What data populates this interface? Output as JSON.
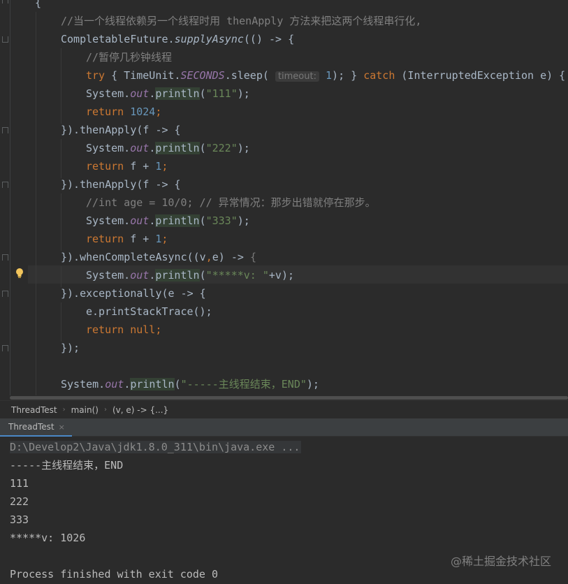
{
  "editor": {
    "lines": [
      {
        "tokens": [
          {
            "t": "{",
            "c": ""
          }
        ]
      },
      {
        "tokens": [
          {
            "t": "//当一个线程依赖另一个线程时用 thenApply 方法来把这两个线程串行化,",
            "c": "c-cm"
          }
        ]
      },
      {
        "tokens": [
          {
            "t": "CompletableFuture.",
            "c": ""
          },
          {
            "t": "supplyAsync",
            "c": "c-static"
          },
          {
            "t": "(() -> {",
            "c": ""
          }
        ]
      },
      {
        "tokens": [
          {
            "t": "//暂停几秒钟线程",
            "c": "c-cm"
          }
        ]
      },
      {
        "tokens": [
          {
            "t": "try",
            "c": "c-kw"
          },
          {
            "t": " { TimeUnit.",
            "c": ""
          },
          {
            "t": "SECONDS",
            "c": "c-fld"
          },
          {
            "t": ".sleep( ",
            "c": ""
          },
          {
            "t": "timeout:",
            "c": "c-hint"
          },
          {
            "t": " ",
            "c": ""
          },
          {
            "t": "1",
            "c": "c-num"
          },
          {
            "t": "); } ",
            "c": ""
          },
          {
            "t": "catch",
            "c": "c-kw"
          },
          {
            "t": " (InterruptedException e) { e",
            "c": ""
          }
        ]
      },
      {
        "tokens": [
          {
            "t": "System.",
            "c": ""
          },
          {
            "t": "out",
            "c": "c-fld"
          },
          {
            "t": ".",
            "c": ""
          },
          {
            "t": "println",
            "c": "c-usage"
          },
          {
            "t": "(",
            "c": ""
          },
          {
            "t": "\"111\"",
            "c": "c-str"
          },
          {
            "t": ");",
            "c": ""
          }
        ]
      },
      {
        "tokens": [
          {
            "t": "return",
            "c": "c-kw"
          },
          {
            "t": " ",
            "c": ""
          },
          {
            "t": "1024",
            "c": "c-num"
          },
          {
            "t": ";",
            "c": "c-kw"
          }
        ]
      },
      {
        "tokens": [
          {
            "t": "}).thenApply(f -> {",
            "c": ""
          }
        ]
      },
      {
        "tokens": [
          {
            "t": "System.",
            "c": ""
          },
          {
            "t": "out",
            "c": "c-fld"
          },
          {
            "t": ".",
            "c": ""
          },
          {
            "t": "println",
            "c": "c-usage"
          },
          {
            "t": "(",
            "c": ""
          },
          {
            "t": "\"222\"",
            "c": "c-str"
          },
          {
            "t": ");",
            "c": ""
          }
        ]
      },
      {
        "tokens": [
          {
            "t": "return",
            "c": "c-kw"
          },
          {
            "t": " f + ",
            "c": ""
          },
          {
            "t": "1",
            "c": "c-num"
          },
          {
            "t": ";",
            "c": "c-kw"
          }
        ]
      },
      {
        "tokens": [
          {
            "t": "}).thenApply(f -> {",
            "c": ""
          }
        ]
      },
      {
        "tokens": [
          {
            "t": "//int age = 10/0; // 异常情况：那步出错就停在那步。",
            "c": "c-cm"
          }
        ]
      },
      {
        "tokens": [
          {
            "t": "System.",
            "c": ""
          },
          {
            "t": "out",
            "c": "c-fld"
          },
          {
            "t": ".",
            "c": ""
          },
          {
            "t": "println",
            "c": "c-usage"
          },
          {
            "t": "(",
            "c": ""
          },
          {
            "t": "\"333\"",
            "c": "c-str"
          },
          {
            "t": ");",
            "c": ""
          }
        ]
      },
      {
        "tokens": [
          {
            "t": "return",
            "c": "c-kw"
          },
          {
            "t": " f + ",
            "c": ""
          },
          {
            "t": "1",
            "c": "c-num"
          },
          {
            "t": ";",
            "c": "c-kw"
          }
        ]
      },
      {
        "tokens": [
          {
            "t": "}).whenCompleteAsync((v",
            "c": ""
          },
          {
            "t": ",",
            "c": "c-kw"
          },
          {
            "t": "e) -> ",
            "c": ""
          },
          {
            "t": "{",
            "c": "c-gray"
          }
        ]
      },
      {
        "tokens": [
          {
            "t": "System.",
            "c": ""
          },
          {
            "t": "out",
            "c": "c-fld"
          },
          {
            "t": ".",
            "c": ""
          },
          {
            "t": "println",
            "c": "c-usage"
          },
          {
            "t": "(",
            "c": ""
          },
          {
            "t": "\"*****v: \"",
            "c": "c-str"
          },
          {
            "t": "+v);",
            "c": ""
          }
        ]
      },
      {
        "tokens": [
          {
            "t": "}).exceptionally(e -> {",
            "c": ""
          }
        ]
      },
      {
        "tokens": [
          {
            "t": "e.printStackTrace();",
            "c": ""
          }
        ]
      },
      {
        "tokens": [
          {
            "t": "return",
            "c": "c-kw"
          },
          {
            "t": " ",
            "c": ""
          },
          {
            "t": "null",
            "c": "c-kw"
          },
          {
            "t": ";",
            "c": "c-kw"
          }
        ]
      },
      {
        "tokens": [
          {
            "t": "});",
            "c": ""
          }
        ]
      },
      {
        "tokens": []
      },
      {
        "tokens": [
          {
            "t": "System.",
            "c": ""
          },
          {
            "t": "out",
            "c": "c-fld"
          },
          {
            "t": ".",
            "c": ""
          },
          {
            "t": "println",
            "c": "c-usage"
          },
          {
            "t": "(",
            "c": ""
          },
          {
            "t": "\"-----主线程结束，END\"",
            "c": "c-str"
          },
          {
            "t": ");",
            "c": ""
          }
        ]
      }
    ]
  },
  "breadcrumbs": [
    "ThreadTest",
    "main()",
    "(v, e) -> {...}"
  ],
  "run_tab": {
    "label": "ThreadTest",
    "close": "×"
  },
  "console": {
    "lines": [
      "D:\\Develop2\\Java\\jdk1.8.0_311\\bin\\java.exe ...",
      "-----主线程结束，END",
      "111",
      "222",
      "333",
      "*****v: 1026",
      "",
      "Process finished with exit code 0"
    ]
  },
  "watermark": "@稀土掘金技术社区",
  "colors": {
    "background": "#2b2b2b",
    "keyword": "#cc7832",
    "number": "#6897bb",
    "string": "#6a8759",
    "field": "#9876aa",
    "comment": "#808080",
    "tab_underline": "#4a88c7"
  }
}
